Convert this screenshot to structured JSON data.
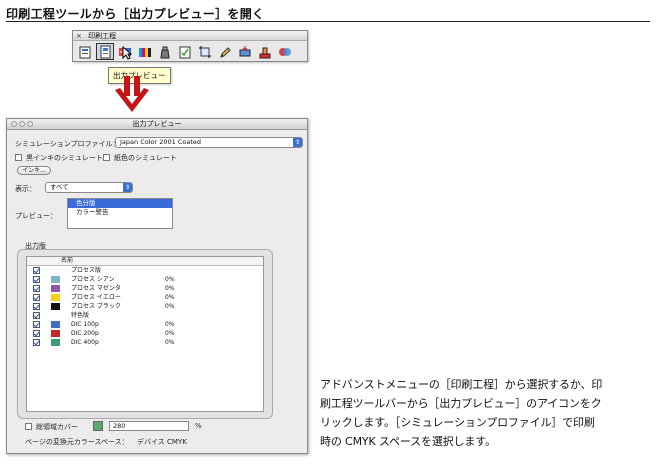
{
  "heading": "印刷工程ツールから［出力プレビュー］を開く",
  "palette": {
    "title": "印刷工程",
    "close_glyph": "×",
    "tools": [
      {
        "icon": "output-preview-tool-icon",
        "active": false
      },
      {
        "icon": "output-preview-document-icon",
        "active": true
      },
      {
        "icon": "separation-tool-icon",
        "active": false
      },
      {
        "icon": "color-bars-tool-icon",
        "active": false
      },
      {
        "icon": "ink-bottle-tool-icon",
        "active": false
      },
      {
        "icon": "preflight-tool-icon",
        "active": false
      },
      {
        "icon": "crop-marks-tool-icon",
        "active": false
      },
      {
        "icon": "pencil-tool-icon",
        "active": false
      },
      {
        "icon": "flattener-tool-icon",
        "active": false
      },
      {
        "icon": "stamp-tool-icon",
        "active": false
      },
      {
        "icon": "convert-colors-tool-icon",
        "active": false
      }
    ]
  },
  "tooltip": "出力プレビュー",
  "window": {
    "title": "出力プレビュー",
    "simulation_profile_label": "シミュレーションプロファイル：",
    "simulation_profile_value": "Japan Color 2001 Coated",
    "simulate_paper_label": "黒インキのシミュレート",
    "simulate_spot_label": "紙色のシミュレート",
    "ink_manager_button": "インキ...",
    "show_label": "表示：",
    "show_value": "すべて",
    "preview_label": "プレビュー：",
    "preview_options": [
      "色分版",
      "カラー警告"
    ],
    "separations_label": "出力版",
    "table_header": "名前",
    "rows": [
      {
        "type": "group",
        "name": "プロセス版",
        "checked": true,
        "color": "",
        "pct": ""
      },
      {
        "type": "ink",
        "name": "プロセス シアン",
        "checked": true,
        "color": "#7ab7c4",
        "pct": "0%"
      },
      {
        "type": "ink",
        "name": "プロセス マゼンタ",
        "checked": true,
        "color": "#8d58a0",
        "pct": "0%"
      },
      {
        "type": "ink",
        "name": "プロセス イエロー",
        "checked": true,
        "color": "#f2d21a",
        "pct": "0%"
      },
      {
        "type": "ink",
        "name": "プロセス ブラック",
        "checked": true,
        "color": "#111111",
        "pct": "0%"
      },
      {
        "type": "group",
        "name": "特色版",
        "checked": true,
        "color": "",
        "pct": ""
      },
      {
        "type": "ink",
        "name": "DIC 100p",
        "checked": true,
        "color": "#3f6fc0",
        "pct": "0%"
      },
      {
        "type": "ink",
        "name": "DIC 200p",
        "checked": true,
        "color": "#c02a2a",
        "pct": "0%"
      },
      {
        "type": "ink",
        "name": "DIC 400p",
        "checked": true,
        "color": "#3e9b78",
        "pct": "0%"
      }
    ],
    "total_coverage_label": "総領域カバー",
    "total_coverage_value": "280",
    "total_coverage_unit": "%",
    "page_color_space_label": "ページの変換元カラースペース：",
    "page_color_space_value": "デバイス CMYK"
  },
  "description": [
    "アドバンストメニューの［印刷工程］から選択するか、印",
    "刷工程ツールバーから［出力プレビュー］のアイコンをク",
    "リックします。［シミュレーションプロファイル］で印刷",
    "時の CMYK スペースを選択します。"
  ]
}
